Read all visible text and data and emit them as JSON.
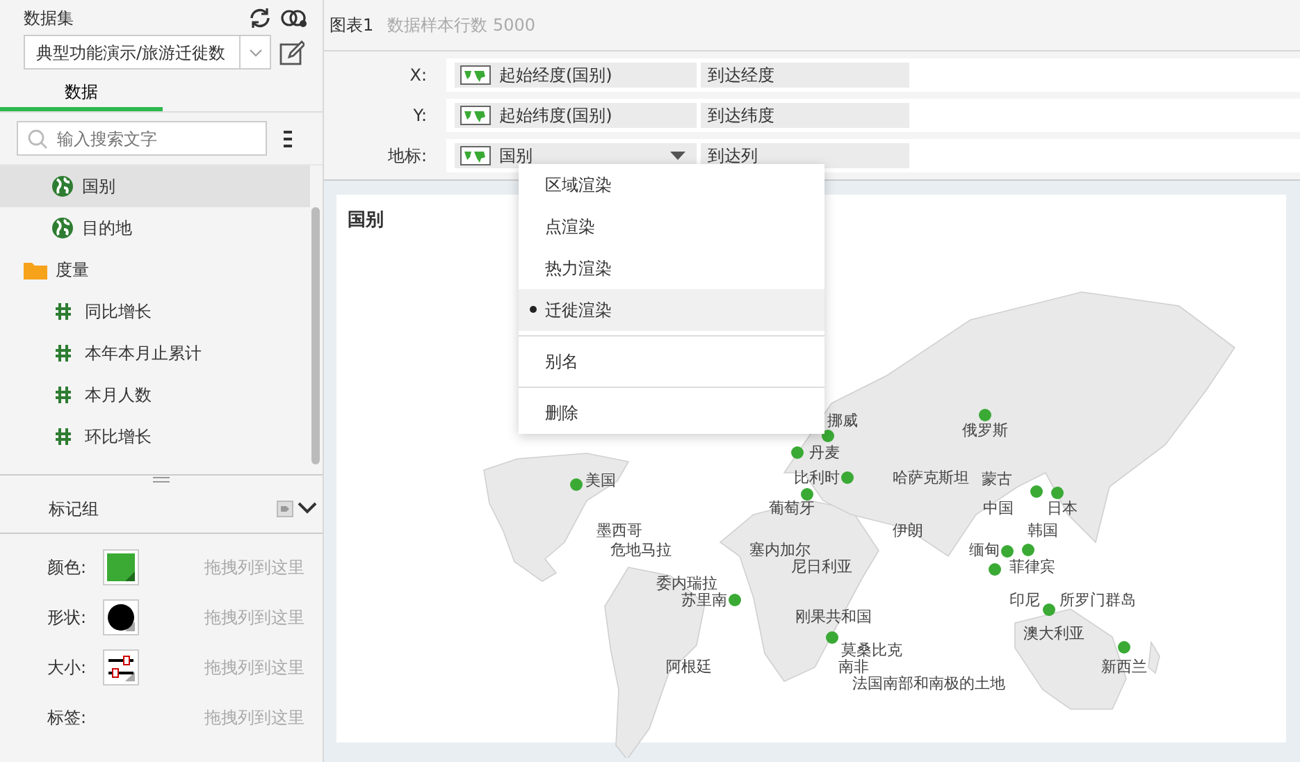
{
  "sidebar": {
    "dataset_label": "数据集",
    "dataset_value": "典型功能演示/旅游迁徙数",
    "tabs": [
      {
        "label": "数据",
        "selected": true
      }
    ],
    "search": {
      "placeholder": "输入搜索文字"
    },
    "fields": [
      {
        "kind": "geo",
        "label": "国别",
        "selected": true
      },
      {
        "kind": "geo",
        "label": "目的地",
        "selected": false
      },
      {
        "kind": "folder",
        "label": "度量",
        "selected": false
      },
      {
        "kind": "measure",
        "label": "同比增长",
        "selected": false
      },
      {
        "kind": "measure",
        "label": "本年本月止累计",
        "selected": false
      },
      {
        "kind": "measure",
        "label": "本月人数",
        "selected": false
      },
      {
        "kind": "measure",
        "label": "环比增长",
        "selected": false
      }
    ],
    "marks": {
      "title": "标记组",
      "rows": [
        {
          "kind": "color",
          "label": "颜色:",
          "hint": "拖拽列到这里",
          "color": "#3aaa35"
        },
        {
          "kind": "shape",
          "label": "形状:",
          "hint": "拖拽列到这里"
        },
        {
          "kind": "size",
          "label": "大小:",
          "hint": "拖拽列到这里"
        },
        {
          "kind": "label",
          "label": "标签:",
          "hint": "拖拽列到这里"
        }
      ]
    }
  },
  "chart_header": {
    "title": "图表1",
    "sample": "数据样本行数 5000"
  },
  "shelves": [
    {
      "label": "X:",
      "field": "起始经度(国别)",
      "target": "到达经度",
      "dropdown": false
    },
    {
      "label": "Y:",
      "field": "起始纬度(国别)",
      "target": "到达纬度",
      "dropdown": false
    },
    {
      "label": "地标:",
      "field": "国别",
      "target": "到达列",
      "dropdown": true
    }
  ],
  "menu": {
    "items": [
      {
        "kind": "option",
        "label": "区域渲染",
        "selected": false
      },
      {
        "kind": "option",
        "label": "点渲染",
        "selected": false
      },
      {
        "kind": "option",
        "label": "热力渲染",
        "selected": false
      },
      {
        "kind": "option",
        "label": "迁徙渲染",
        "selected": true
      },
      {
        "kind": "action",
        "label": "别名"
      },
      {
        "kind": "action",
        "label": "删除"
      }
    ]
  },
  "map": {
    "title": "国别",
    "labels": [
      "挪威",
      "俄罗斯",
      "丹麦",
      "美国",
      "比利时",
      "哈萨克斯坦",
      "蒙古",
      "葡萄牙",
      "中国",
      "日本",
      "墨西哥",
      "伊朗",
      "韩国",
      "危地马拉",
      "塞内加尔",
      "缅甸",
      "尼日利亚",
      "菲律宾",
      "委内瑞拉",
      "苏里南",
      "印尼",
      "所罗门群岛",
      "刚果共和国",
      "澳大利亚",
      "莫桑比克",
      "阿根廷",
      "南非",
      "新西兰",
      "法国南部和南极的土地"
    ]
  }
}
